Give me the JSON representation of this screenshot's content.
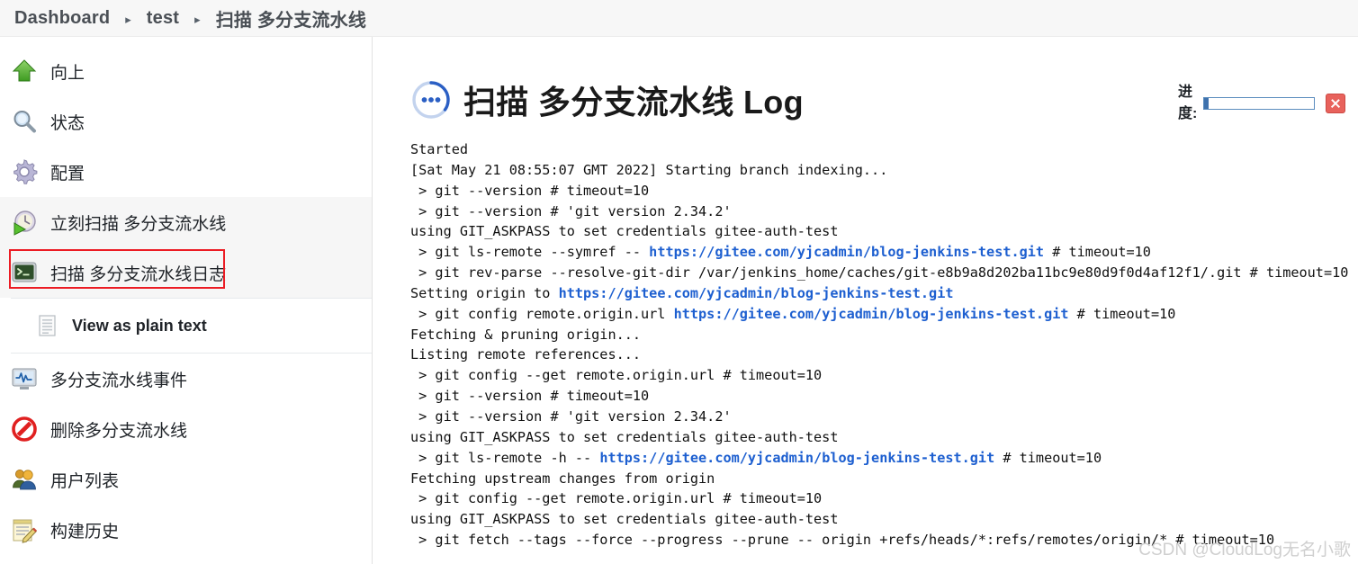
{
  "breadcrumb": {
    "items": [
      {
        "label": "Dashboard"
      },
      {
        "label": "test"
      },
      {
        "label": "扫描 多分支流水线"
      }
    ],
    "separator": "▸"
  },
  "sidebar": {
    "items": [
      {
        "label": "向上",
        "icon": "up-arrow-icon",
        "shaded": false,
        "highlighted": false
      },
      {
        "label": "状态",
        "icon": "magnifier-icon",
        "shaded": false,
        "highlighted": false
      },
      {
        "label": "配置",
        "icon": "gear-icon",
        "shaded": false,
        "highlighted": false
      },
      {
        "label": "立刻扫描 多分支流水线",
        "icon": "clock-play-icon",
        "shaded": true,
        "highlighted": false
      },
      {
        "label": "扫描 多分支流水线日志",
        "icon": "console-icon",
        "shaded": true,
        "highlighted": true
      },
      {
        "label": "View as plain text",
        "icon": "document-icon",
        "shaded": false,
        "highlighted": false,
        "sub": true
      },
      {
        "label": "多分支流水线事件",
        "icon": "monitor-pulse-icon",
        "shaded": false,
        "highlighted": false
      },
      {
        "label": "删除多分支流水线",
        "icon": "no-entry-icon",
        "shaded": false,
        "highlighted": false
      },
      {
        "label": "用户列表",
        "icon": "users-icon",
        "shaded": false,
        "highlighted": false
      },
      {
        "label": "构建历史",
        "icon": "notepad-pencil-icon",
        "shaded": false,
        "highlighted": false
      }
    ]
  },
  "main": {
    "title": "扫描 多分支流水线 Log",
    "title_icon": "in-progress-spinner-icon",
    "progress": {
      "label": "进度:",
      "percent": 4,
      "stop_button_title": "×"
    },
    "log_lines": [
      [
        {
          "t": "Started"
        }
      ],
      [
        {
          "t": "[Sat May 21 08:55:07 GMT 2022] Starting branch indexing..."
        }
      ],
      [
        {
          "t": " > git --version # timeout=10"
        }
      ],
      [
        {
          "t": " > git --version # 'git version 2.34.2'"
        }
      ],
      [
        {
          "t": "using GIT_ASKPASS to set credentials gitee-auth-test"
        }
      ],
      [
        {
          "t": " > git ls-remote --symref -- "
        },
        {
          "t": "https://gitee.com/yjcadmin/blog-jenkins-test.git",
          "url": true
        },
        {
          "t": " # timeout=10"
        }
      ],
      [
        {
          "t": " > git rev-parse --resolve-git-dir /var/jenkins_home/caches/git-e8b9a8d202ba11bc9e80d9f0d4af12f1/.git # timeout=10"
        }
      ],
      [
        {
          "t": "Setting origin to "
        },
        {
          "t": "https://gitee.com/yjcadmin/blog-jenkins-test.git",
          "url": true
        }
      ],
      [
        {
          "t": " > git config remote.origin.url "
        },
        {
          "t": "https://gitee.com/yjcadmin/blog-jenkins-test.git",
          "url": true
        },
        {
          "t": " # timeout=10"
        }
      ],
      [
        {
          "t": "Fetching & pruning origin..."
        }
      ],
      [
        {
          "t": "Listing remote references..."
        }
      ],
      [
        {
          "t": " > git config --get remote.origin.url # timeout=10"
        }
      ],
      [
        {
          "t": " > git --version # timeout=10"
        }
      ],
      [
        {
          "t": " > git --version # 'git version 2.34.2'"
        }
      ],
      [
        {
          "t": "using GIT_ASKPASS to set credentials gitee-auth-test"
        }
      ],
      [
        {
          "t": " > git ls-remote -h -- "
        },
        {
          "t": "https://gitee.com/yjcadmin/blog-jenkins-test.git",
          "url": true
        },
        {
          "t": " # timeout=10"
        }
      ],
      [
        {
          "t": "Fetching upstream changes from origin"
        }
      ],
      [
        {
          "t": " > git config --get remote.origin.url # timeout=10"
        }
      ],
      [
        {
          "t": "using GIT_ASKPASS to set credentials gitee-auth-test"
        }
      ],
      [
        {
          "t": " > git fetch --tags --force --progress --prune -- origin +refs/heads/*:refs/remotes/origin/* # timeout=10"
        }
      ]
    ]
  },
  "watermark": "CSDN @CloudLog无名小歌",
  "colors": {
    "link": "#1d5fd0",
    "progress_fill": "#3f72ad",
    "progress_border": "#5b8cbe",
    "highlight_border": "#ec1c24",
    "stop_button": "#e8625c",
    "row_shade": "#f6f6f6",
    "breadcrumb_bg": "#f7f7f7"
  }
}
